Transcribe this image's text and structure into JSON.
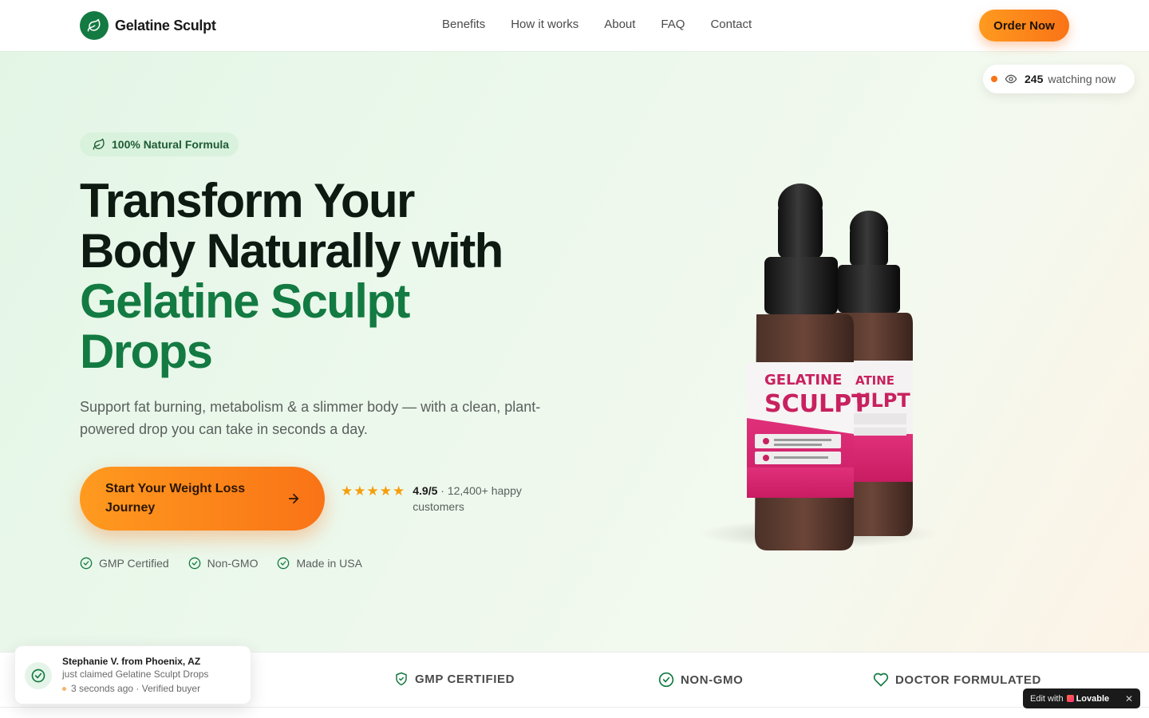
{
  "nav": {
    "brand_name": "Gelatine Sculpt",
    "links": [
      "Benefits",
      "How it works",
      "About",
      "FAQ",
      "Contact"
    ],
    "order_button": "Order Now"
  },
  "live_viewers": {
    "count": "245",
    "label": "watching now",
    "icon": "eye-icon"
  },
  "hero": {
    "pill": "100% Natural Formula",
    "headline_line1": "Transform Your",
    "headline_line2": "Body Naturally with",
    "headline_highlight_1": "Gelatine Sculpt",
    "headline_highlight_2": "Drops",
    "subtext": "Support fat burning, metabolism & a slimmer body — with a clean, plant-powered drop you can take in seconds a day.",
    "cta_label": "Start Your Weight Loss Journey",
    "rating": {
      "stars": 5,
      "score": "4.9/5",
      "text": " · 12,400+ happy customers"
    },
    "badges": [
      "GMP Certified",
      "Non-GMO",
      "Made in USA"
    ]
  },
  "product": {
    "label_top": "GELATINE",
    "label_main": "SCULPT",
    "back_label_top": "ATINE",
    "back_label_main": "ULPT"
  },
  "trust_bar": {
    "items": [
      "GMP CERTIFIED",
      "NON-GMO",
      "DOCTOR FORMULATED"
    ]
  },
  "toast": {
    "name": "Stephanie V. from Phoenix, AZ",
    "action": "just claimed Gelatine Sculpt Drops",
    "meta": "3 seconds ago · Verified buyer"
  },
  "lovable_badge": {
    "prefix": "Edit with",
    "brand": "Lovable",
    "close": "✕"
  },
  "colors": {
    "brand_green": "#137a42",
    "accent_orange": "#f97316",
    "star": "#f59e0b"
  }
}
